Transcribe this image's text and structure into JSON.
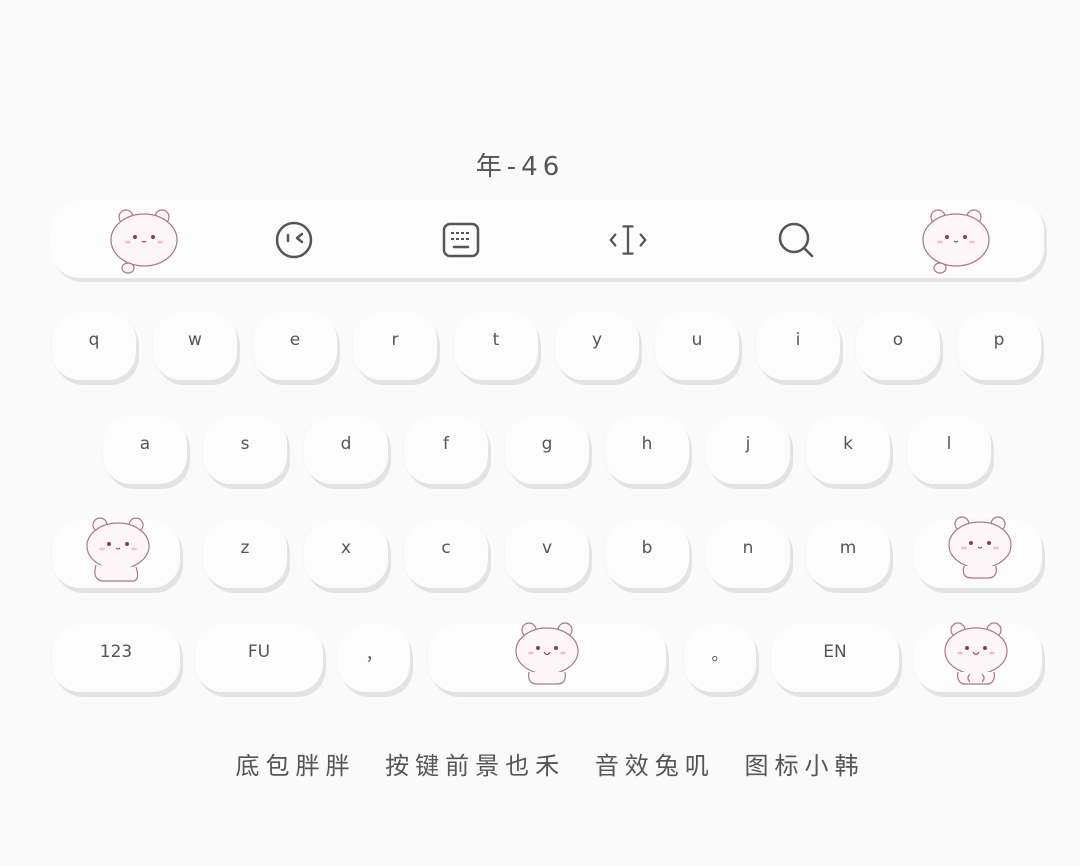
{
  "header": {
    "title": "年-46"
  },
  "toolbar": {
    "items": [
      {
        "icon": "bear-mascot-icon"
      },
      {
        "icon": "emoji-wink-icon"
      },
      {
        "icon": "keyboard-icon"
      },
      {
        "icon": "text-cursor-icon"
      },
      {
        "icon": "search-icon"
      },
      {
        "icon": "bear-mascot-icon"
      }
    ]
  },
  "keyboard": {
    "row1": [
      "q",
      "w",
      "e",
      "r",
      "t",
      "y",
      "u",
      "i",
      "o",
      "p"
    ],
    "row2": [
      "a",
      "s",
      "d",
      "f",
      "g",
      "h",
      "j",
      "k",
      "l"
    ],
    "row3": [
      "z",
      "x",
      "c",
      "v",
      "b",
      "n",
      "m"
    ],
    "row4": {
      "numbers": "123",
      "fu": "FU",
      "comma": "，",
      "period": "。",
      "lang": "EN"
    },
    "shift_icon": "bear-mascot-icon",
    "delete_icon": "bear-mascot-icon",
    "space_icon": "bear-mascot-icon",
    "enter_icon": "bear-mascot-icon"
  },
  "footer": {
    "credit1": "底包胖胖",
    "credit2": "按键前景也禾",
    "credit3": "音效兔叽",
    "credit4": "图标小韩"
  },
  "colors": {
    "background": "#fafafa",
    "key": "#fcfcfc",
    "key_shadow": "#e3e3e3",
    "text": "#555555",
    "mascot_outline": "#a87a86",
    "mascot_fill": "#fdf6f8",
    "mascot_blush": "#f2c2cc"
  }
}
